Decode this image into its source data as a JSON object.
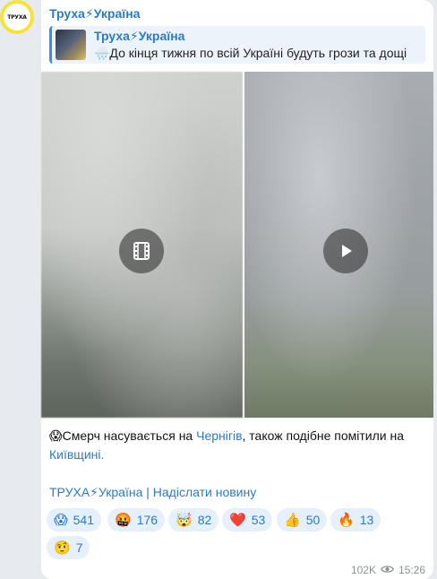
{
  "channel": {
    "name": "Труха⚡Україна",
    "avatar_text": "ТРУХА"
  },
  "reply": {
    "title": "Труха⚡Україна",
    "text": "🌧️До кінця тижня по всій Україні будуть грози та дощі"
  },
  "media": {
    "left_icon": "film-icon",
    "right_icon": "play-icon"
  },
  "caption": {
    "emoji": "😱",
    "part1": "Смерч насувається на ",
    "link1": "Чернігів",
    "part2": ", також подібне помітили на ",
    "link2": "Київщині."
  },
  "footer": {
    "link_text": "ТРУХА⚡Україна | Надіслати новину"
  },
  "reactions": [
    {
      "emoji": "😱",
      "count": "541"
    },
    {
      "emoji": "🤬",
      "count": "176"
    },
    {
      "emoji": "🤯",
      "count": "82"
    },
    {
      "emoji": "❤️",
      "count": "53"
    },
    {
      "emoji": "👍",
      "count": "50"
    },
    {
      "emoji": "🔥",
      "count": "13"
    },
    {
      "emoji": "🤨",
      "count": "7"
    }
  ],
  "meta": {
    "views": "102K",
    "time": "15:26"
  },
  "colors": {
    "accent": "#2b7bc2",
    "reaction_bg": "#e6f0fa",
    "chat_bg": "#e7ebf0"
  }
}
